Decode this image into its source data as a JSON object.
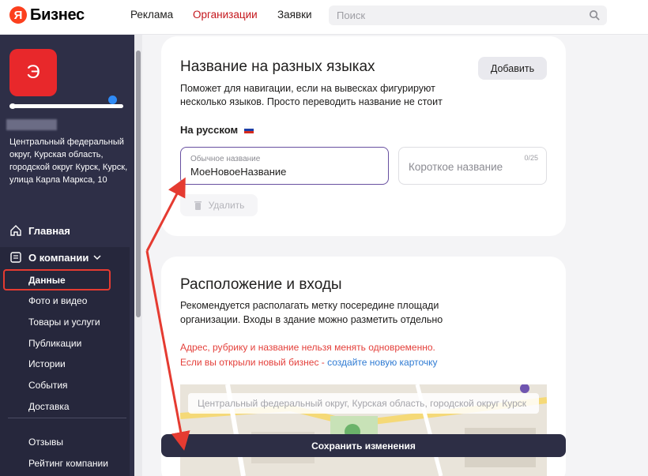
{
  "brand": {
    "logo_letter": "Я",
    "name": "Бизнес"
  },
  "nav": {
    "items": [
      "Реклама",
      "Организации",
      "Заявки"
    ],
    "active": "Организации"
  },
  "search": {
    "placeholder": "Поиск"
  },
  "profile": {
    "avatar_letter": "Э",
    "address": "Центральный федеральный округ, Курская область, городской округ Курск, Курск, улица Карла Маркса, 10"
  },
  "sidebar": {
    "home": "Главная",
    "about": "О компании",
    "items": [
      "Данные",
      "Фото и видео",
      "Товары и услуги",
      "Публикации",
      "Истории",
      "События",
      "Доставка"
    ],
    "items2": [
      "Отзывы",
      "Рейтинг компании"
    ]
  },
  "names_card": {
    "title": "Название на разных языках",
    "desc1": "Поможет для навигации, если на вывесках фигурируют",
    "desc2": "несколько языков. Просто переводить название не стоит",
    "add_label": "Добавить",
    "lang_label": "На русском",
    "main_field_label": "Обычное название",
    "main_field_value": "МоеНовоеНазвание",
    "short_placeholder": "Короткое название",
    "short_counter": "0/25",
    "delete_label": "Удалить"
  },
  "location_card": {
    "title": "Расположение и входы",
    "desc1": "Рекомендуется располагать метку посередине площади",
    "desc2": "организации. Входы в здание можно разметить отдельно",
    "warn1": "Адрес, рубрику и название нельзя менять одновременно.",
    "warn2_prefix": "Если вы открыли новый бизнес - ",
    "warn2_link": "создайте новую карточку",
    "map_address": "Центральный федеральный округ, Курская область, городской округ Курск"
  },
  "save_label": "Сохранить изменения",
  "colors": {
    "accent_red": "#e53b31",
    "sidebar": "#2e2f47",
    "link": "#2f7bd3"
  }
}
